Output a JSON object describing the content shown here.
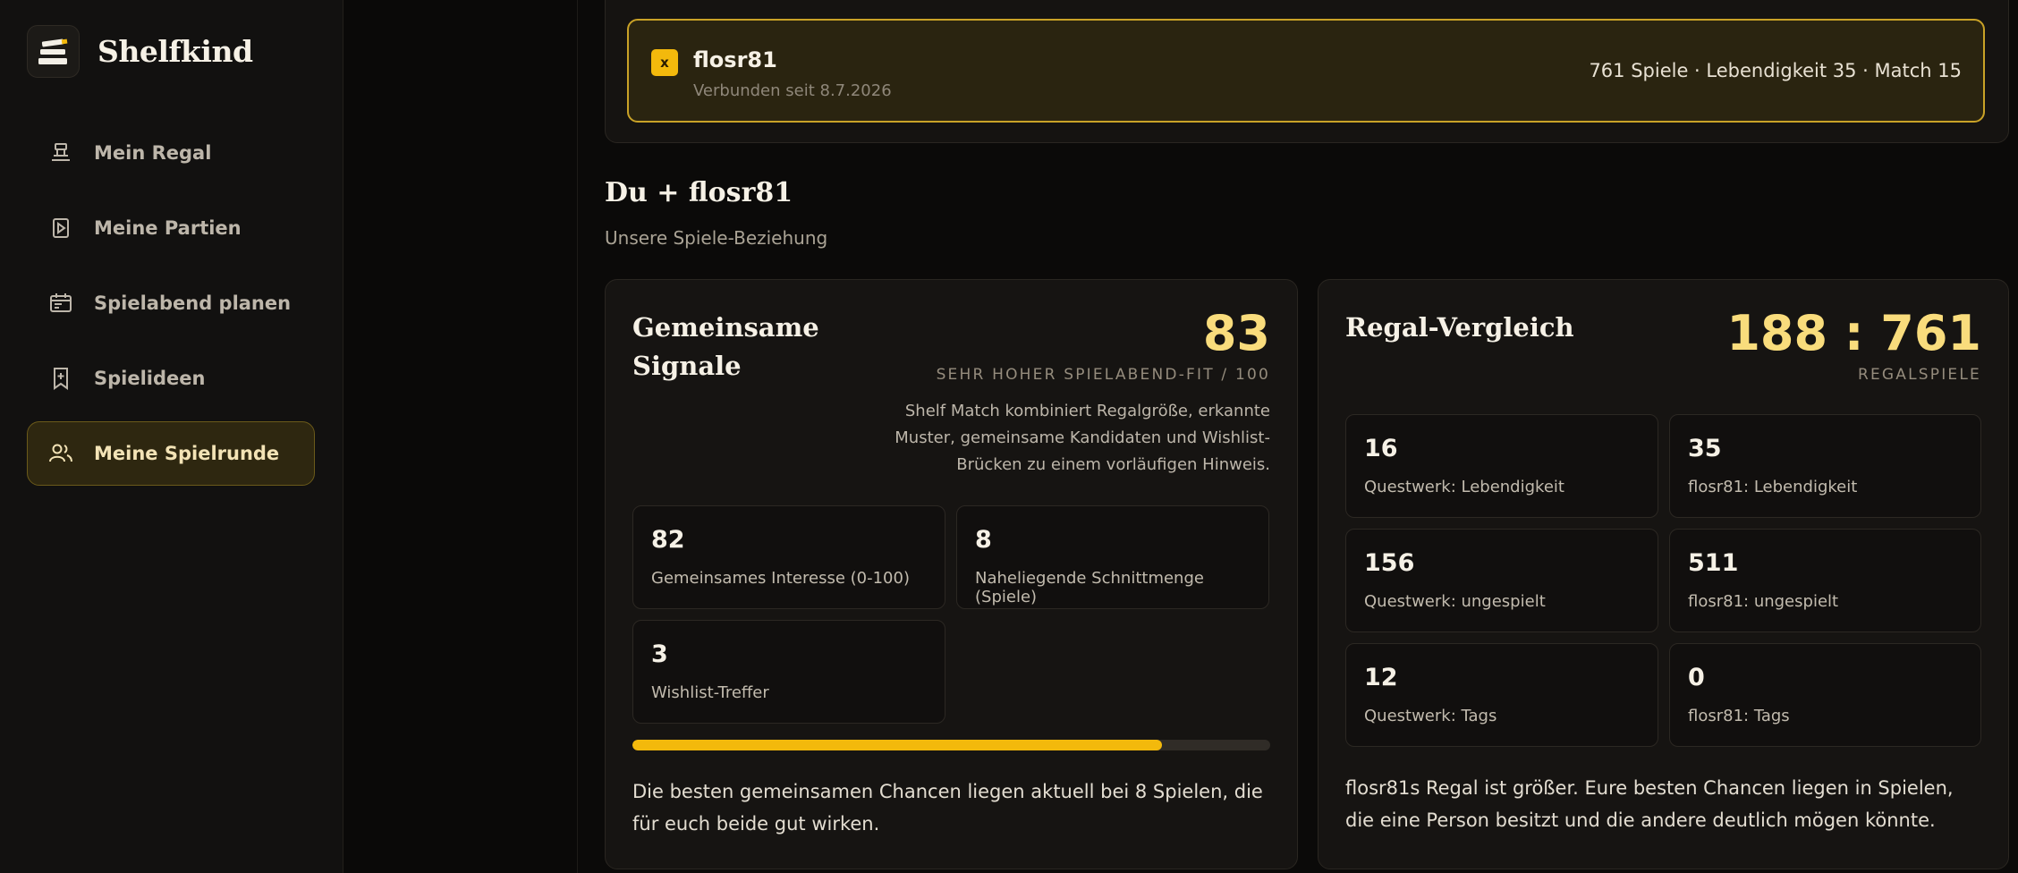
{
  "app": {
    "name": "Shelfkind"
  },
  "sidebar": {
    "items": [
      {
        "label": "Mein Regal",
        "icon": "shelf-icon",
        "active": false
      },
      {
        "label": "Meine Partien",
        "icon": "play-icon",
        "active": false
      },
      {
        "label": "Spielabend planen",
        "icon": "calendar-icon",
        "active": false
      },
      {
        "label": "Spielideen",
        "icon": "bookmark-plus-icon",
        "active": false
      },
      {
        "label": "Meine Spielrunde",
        "icon": "users-icon",
        "active": true
      }
    ]
  },
  "connection": {
    "badge": "x",
    "name": "flosr81",
    "since": "Verbunden seit 8.7.2026",
    "stats": "761 Spiele · Lebendigkeit 35 · Match 15"
  },
  "section": {
    "title": "Du + flosr81",
    "subtitle": "Unsere Spiele-Beziehung"
  },
  "signals": {
    "title_line1": "Gemeinsame",
    "title_line2": "Signale",
    "score": "83",
    "score_caption": "SEHR HOHER SPIELABEND-FIT / 100",
    "description": "Shelf Match kombiniert Regalgröße, erkannte Muster, gemeinsame Kandidaten und Wishlist-Brücken zu einem vorläufigen Hinweis.",
    "stats": [
      {
        "value": "82",
        "label": "Gemeinsames Interesse (0-100)"
      },
      {
        "value": "8",
        "label": "Naheliegende Schnittmenge (Spiele)"
      },
      {
        "value": "3",
        "label": "Wishlist-Treffer"
      }
    ],
    "progress_percent": 83,
    "summary": "Die besten gemeinsamen Chancen liegen aktuell bei 8 Spielen, die für euch beide gut wirken."
  },
  "comparison": {
    "title": "Regal-Vergleich",
    "score": "188 : 761",
    "score_caption": "REGALSPIELE",
    "stats": [
      {
        "value": "16",
        "label": "Questwerk: Lebendigkeit"
      },
      {
        "value": "35",
        "label": "flosr81: Lebendigkeit"
      },
      {
        "value": "156",
        "label": "Questwerk: ungespielt"
      },
      {
        "value": "511",
        "label": "flosr81: ungespielt"
      },
      {
        "value": "12",
        "label": "Questwerk: Tags"
      },
      {
        "value": "0",
        "label": "flosr81: Tags"
      }
    ],
    "summary": "flosr81s Regal ist größer. Eure besten Chancen liegen in Spielen, die eine Person besitzt und die andere deutlich mögen könnte."
  },
  "colors": {
    "accent": "#f3b90c",
    "accent_text": "#f9dc7c",
    "background": "#0b0a09",
    "card": "#161412"
  }
}
